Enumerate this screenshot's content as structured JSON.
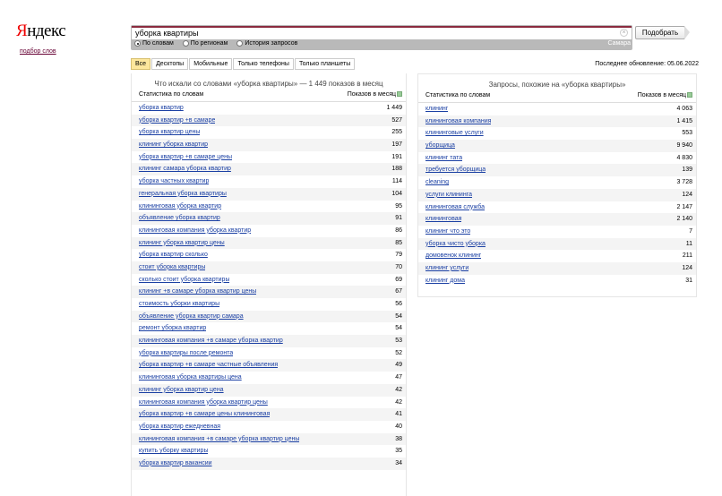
{
  "logo": {
    "first": "Я",
    "rest": "ндекс",
    "sub": "подбор слов"
  },
  "search": {
    "query": "уборка квартиры",
    "region": "Самара",
    "submit": "Подобрать",
    "modes": [
      {
        "label": "По словам",
        "on": true
      },
      {
        "label": "По регионам",
        "on": false
      },
      {
        "label": "История запросов",
        "on": false
      }
    ]
  },
  "tabs": [
    "Все",
    "Десктопы",
    "Мобильные",
    "Только телефоны",
    "Только планшеты"
  ],
  "updated": "Последнее обновление: 05.06.2022",
  "left": {
    "title": "Что искали со словами «уборка квартиры» — 1 449 показов в месяц",
    "col1": "Статистика по словам",
    "col2": "Показов в месяц",
    "rows": [
      [
        "уборка квартир",
        "1 449"
      ],
      [
        "уборка квартир +в самаре",
        "527"
      ],
      [
        "уборка квартир цены",
        "255"
      ],
      [
        "клининг уборка квартир",
        "197"
      ],
      [
        "уборка квартир +в самаре цены",
        "191"
      ],
      [
        "клининг самара уборка квартир",
        "188"
      ],
      [
        "уборка частных квартир",
        "114"
      ],
      [
        "генеральная уборка квартиры",
        "104"
      ],
      [
        "клининговая уборка квартир",
        "95"
      ],
      [
        "объявление уборка квартир",
        "91"
      ],
      [
        "клининговая компания уборка квартир",
        "86"
      ],
      [
        "клининг уборка квартир цены",
        "85"
      ],
      [
        "уборка квартир сколько",
        "79"
      ],
      [
        "стоит уборка квартиры",
        "70"
      ],
      [
        "сколько стоит уборка квартиры",
        "69"
      ],
      [
        "клининг +в самаре уборка квартир цены",
        "67"
      ],
      [
        "стоимость уборки квартиры",
        "56"
      ],
      [
        "объявление уборка квартир самара",
        "54"
      ],
      [
        "ремонт уборка квартир",
        "54"
      ],
      [
        "клининговая компания +в самаре уборка квартир",
        "53"
      ],
      [
        "уборка квартиры после ремонта",
        "52"
      ],
      [
        "уборка квартир +в самаре частные объявления",
        "49"
      ],
      [
        "клининговая уборка квартиры цена",
        "47"
      ],
      [
        "клининг уборка квартир цена",
        "42"
      ],
      [
        "клининговая компания уборка квартир цены",
        "42"
      ],
      [
        "уборка квартир +в самаре цены клининговая",
        "41"
      ],
      [
        "уборка квартир ежедневная",
        "40"
      ],
      [
        "клининговая компания +в самаре уборка квартир цены",
        "38"
      ],
      [
        "купить уборку квартиры",
        "35"
      ],
      [
        "уборка квартир вакансии",
        "34"
      ]
    ]
  },
  "right": {
    "title": "Запросы, похожие на «уборка квартиры»",
    "col1": "Статистика по словам",
    "col2": "Показов в месяц",
    "rows": [
      [
        "клининг",
        "4 063"
      ],
      [
        "клининговая компания",
        "1 415"
      ],
      [
        "клининговые услуги",
        "553"
      ],
      [
        "уборщица",
        "9 940"
      ],
      [
        "клининг тата",
        "4 830"
      ],
      [
        "требуется уборщица",
        "139"
      ],
      [
        "cleaning",
        "3 728"
      ],
      [
        "услуги клининга",
        "124"
      ],
      [
        "клининговая служба",
        "2 147"
      ],
      [
        "клининговая",
        "2 140"
      ],
      [
        "клининг что это",
        "7"
      ],
      [
        "уборка чисто уборка",
        "11"
      ],
      [
        "домовенок клининг",
        "211"
      ],
      [
        "клининг услуги",
        "124"
      ],
      [
        "клининг дома",
        "31"
      ]
    ]
  }
}
